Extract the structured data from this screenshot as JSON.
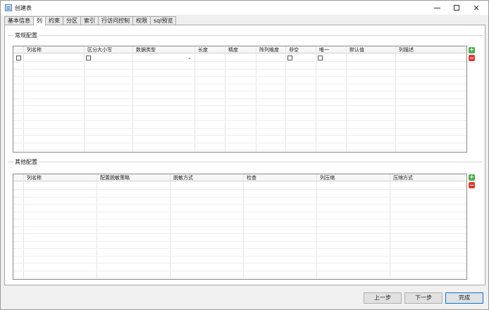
{
  "window": {
    "title": "创建表"
  },
  "tabs": [
    {
      "label": "基本信息"
    },
    {
      "label": "列"
    },
    {
      "label": "约束"
    },
    {
      "label": "分区"
    },
    {
      "label": "索引"
    },
    {
      "label": "行访问控制"
    },
    {
      "label": "权限"
    },
    {
      "label": "sql预览"
    }
  ],
  "active_tab": "列",
  "general_config": {
    "title": "常规配置",
    "columns": [
      "列名称",
      "区分大小写",
      "数据类型",
      "长度",
      "精度",
      "阵列维度",
      "非空",
      "唯一",
      "默认值",
      "列描述"
    ]
  },
  "other_config": {
    "title": "其他配置",
    "columns": [
      "列名称",
      "配置脱敏策略",
      "脱敏方式",
      "检查",
      "列压缩",
      "压缩方式"
    ]
  },
  "buttons": {
    "prev": "上一步",
    "next": "下一步",
    "finish": "完成"
  },
  "icons": {
    "add": "add-row-icon",
    "remove": "remove-row-icon"
  },
  "colors": {
    "add": "#4caf50",
    "remove": "#e53935",
    "primary_border": "#0078d7"
  }
}
